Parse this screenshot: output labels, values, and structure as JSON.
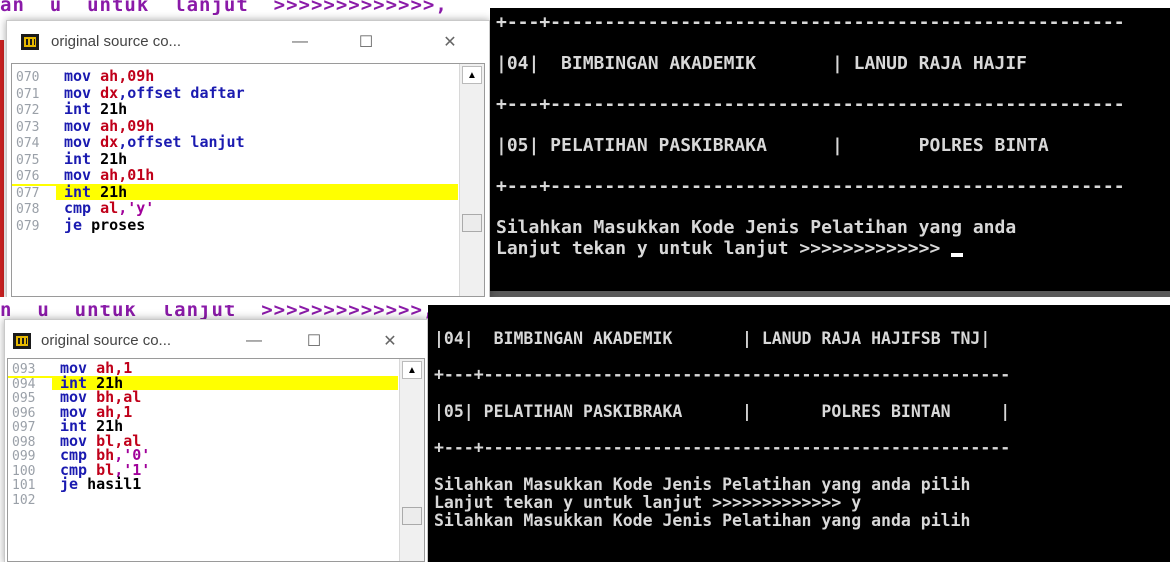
{
  "panel1": {
    "bg_code_text": "an  u  untuk  lanjut  >>>>>>>>>>>>>,",
    "window": {
      "title": "original source co...",
      "minimize_glyph": "—",
      "maximize_glyph": "☐",
      "close_glyph": "✕"
    },
    "code_lines": [
      {
        "num": "070",
        "op": "mov",
        "arg1": "ah",
        "rest": ",09h",
        "highlight": false
      },
      {
        "num": "071",
        "op": "mov",
        "arg1": "dx",
        "rest": ",offset daftar",
        "highlight": false
      },
      {
        "num": "072",
        "op": "int",
        "arg1": "",
        "rest": "21h",
        "highlight": false
      },
      {
        "num": "073",
        "op": "mov",
        "arg1": "ah",
        "rest": ",09h",
        "highlight": false
      },
      {
        "num": "074",
        "op": "mov",
        "arg1": "dx",
        "rest": ",offset lanjut",
        "highlight": false
      },
      {
        "num": "075",
        "op": "int",
        "arg1": "",
        "rest": "21h",
        "highlight": false
      },
      {
        "num": "076",
        "op": "mov",
        "arg1": "ah",
        "rest": ",01h",
        "highlight": false
      },
      {
        "num": "077",
        "op": "int",
        "arg1": "",
        "rest": "21h",
        "highlight": true
      },
      {
        "num": "078",
        "op": "cmp",
        "arg1": "al",
        "rest": ",'y'",
        "highlight": false
      },
      {
        "num": "079",
        "op": "je",
        "arg1": "",
        "rest": "proses",
        "highlight": false
      }
    ],
    "console": [
      "+---+-----------------------------------------------------",
      "",
      "|04|  BIMBINGAN AKADEMIK       | LANUD RAJA HAJIF",
      "",
      "+---+-----------------------------------------------------",
      "",
      "|05| PELATIHAN PASKIBRAKA      |       POLRES BINTA",
      "",
      "+---+-----------------------------------------------------",
      "",
      "Silahkan Masukkan Kode Jenis Pelatihan yang anda",
      "Lanjut tekan y untuk lanjut >>>>>>>>>>>>> "
    ]
  },
  "panel2": {
    "bg_code_text": "n  u  untuk  lanjut  >>>>>>>>>>>>>,",
    "window": {
      "title": "original source co...",
      "minimize_glyph": "—",
      "maximize_glyph": "☐",
      "close_glyph": "✕"
    },
    "code_lines": [
      {
        "num": "093",
        "op": "mov",
        "arg1": "ah",
        "rest": ",1",
        "highlight": false
      },
      {
        "num": "094",
        "op": "int",
        "arg1": "",
        "rest": "21h",
        "highlight": true
      },
      {
        "num": "095",
        "op": "mov",
        "arg1": "bh",
        "rest": ",al",
        "highlight": false
      },
      {
        "num": "096",
        "op": "mov",
        "arg1": "ah",
        "rest": ",1",
        "highlight": false
      },
      {
        "num": "097",
        "op": "int",
        "arg1": "",
        "rest": "21h",
        "highlight": false
      },
      {
        "num": "098",
        "op": "mov",
        "arg1": "bl",
        "rest": ",al",
        "highlight": false
      },
      {
        "num": "099",
        "op": "cmp",
        "arg1": "bh",
        "rest": ",'0'",
        "highlight": false
      },
      {
        "num": "100",
        "op": "cmp",
        "arg1": "bl",
        "rest": ",'1'",
        "highlight": false
      },
      {
        "num": "101",
        "op": "je",
        "arg1": "",
        "rest": "hasil1",
        "highlight": false
      },
      {
        "num": "102",
        "op": "",
        "arg1": "",
        "rest": "",
        "highlight": false
      }
    ],
    "console": [
      "|04|  BIMBINGAN AKADEMIK       | LANUD RAJA HAJIFSB TNJ|",
      "",
      "+---+-----------------------------------------------------",
      "",
      "|05| PELATIHAN PASKIBRAKA      |       POLRES BINTAN     |",
      "",
      "+---+-----------------------------------------------------",
      "",
      "Silahkan Masukkan Kode Jenis Pelatihan yang anda pilih",
      "Lanjut tekan y untuk lanjut >>>>>>>>>>>>> y",
      "Silahkan Masukkan Kode Jenis Pelatihan yang anda pilih"
    ]
  },
  "colors": {
    "highlight": "#ffff00",
    "opcode": "#1a1ab0",
    "register": "#c0001a",
    "string": "#a0009a",
    "console_bg": "#000000",
    "console_text": "#d8d8d8"
  }
}
